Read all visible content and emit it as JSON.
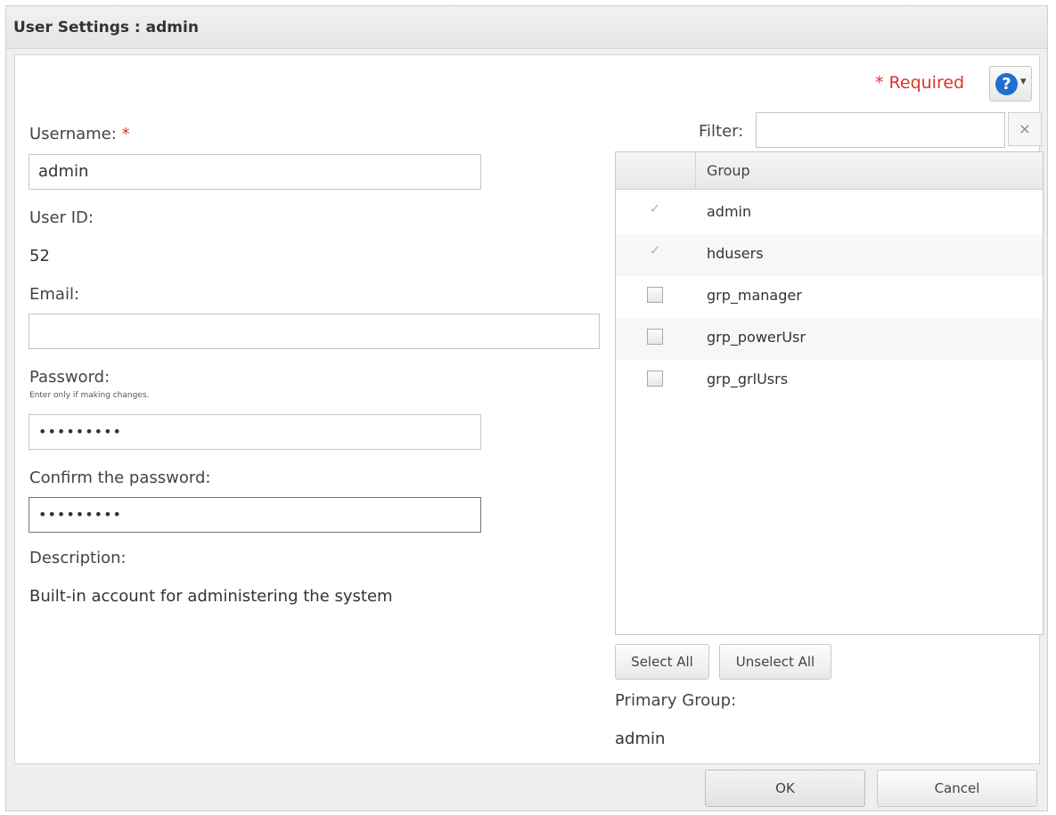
{
  "dialog": {
    "title": "User Settings : admin"
  },
  "header": {
    "required_star": "*",
    "required_label": "Required",
    "help_icon_text": "?",
    "help_caret": "▾"
  },
  "form": {
    "username_label": "Username:",
    "username_required_star": "*",
    "username_value": "admin",
    "user_id_label": "User ID:",
    "user_id_value": "52",
    "email_label": "Email:",
    "email_value": "",
    "password_label": "Password:",
    "password_hint": "Enter only if making changes.",
    "password_value": "•••••••••",
    "confirm_label": "Confirm the password:",
    "confirm_value": "•••••••••",
    "description_label": "Description:",
    "description_value": "Built-in account for administering the system"
  },
  "groups": {
    "filter_label": "Filter:",
    "filter_value": "",
    "clear_icon": "×",
    "column_header": "Group",
    "check_glyph": "✓",
    "rows": [
      {
        "name": "admin",
        "checked": true,
        "disabled": true
      },
      {
        "name": "hdusers",
        "checked": true,
        "disabled": true
      },
      {
        "name": "grp_manager",
        "checked": false,
        "disabled": false
      },
      {
        "name": "grp_powerUsr",
        "checked": false,
        "disabled": false
      },
      {
        "name": "grp_grlUsrs",
        "checked": false,
        "disabled": false
      }
    ],
    "select_all_label": "Select All",
    "unselect_all_label": "Unselect All",
    "primary_group_label": "Primary Group:",
    "primary_group_value": "admin"
  },
  "footer": {
    "ok_label": "OK",
    "cancel_label": "Cancel"
  },
  "colors": {
    "required_red": "#d9352b",
    "help_blue": "#1f6fd1"
  }
}
